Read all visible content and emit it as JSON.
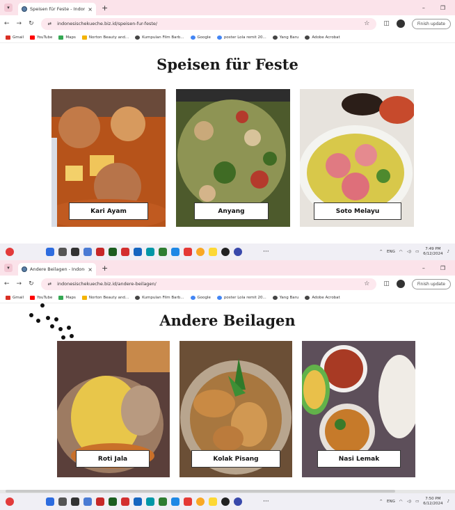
{
  "window1": {
    "tab_title": "Speisen für Feste - Indonesisch",
    "url": "indonesischekueche.biz.id/speisen-fur-feste/",
    "page_title": "Speisen für Feste",
    "cards": [
      {
        "label": "Kari Ayam"
      },
      {
        "label": "Anyang"
      },
      {
        "label": "Soto Melayu"
      }
    ],
    "clock_time": "7:49 PM",
    "clock_date": "6/12/2024"
  },
  "window2": {
    "tab_title": "Andere Beilagen - Indonesische",
    "url": "indonesischekueche.biz.id/andere-beilagen/",
    "page_title": "Andere Beilagen",
    "cards": [
      {
        "label": "Roti Jala"
      },
      {
        "label": "Kolak Pisang"
      },
      {
        "label": "Nasi Lemak"
      }
    ],
    "clock_time": "7:50 PM",
    "clock_date": "6/12/2024"
  },
  "browser": {
    "finish_update": "Finish update",
    "bookmarks": [
      "Gmail",
      "YouTube",
      "Maps",
      "Norton Beauty and...",
      "Kumpulan Film Barb...",
      "Google",
      "poster Lola remit 20...",
      "Yang Baru",
      "Adobe Acrobat"
    ],
    "bookmark_colors": [
      "#d93025",
      "#ff0000",
      "#34a853",
      "#f4b400",
      "#444444",
      "#4285f4",
      "#4285f4",
      "#444444",
      "#444444"
    ]
  },
  "tray": {
    "lang": "ENG"
  },
  "icons": {
    "taskbar_colors": [
      "#2d6cdf",
      "#555555",
      "#333333",
      "#4a7bd4",
      "#c62828",
      "#1b5e20",
      "#d32f2f",
      "#1565c0",
      "#0097a7",
      "#2e7d32",
      "#1e88e5",
      "#e53935",
      "#f9a825",
      "#fdd835",
      "#222222",
      "#3949ab"
    ]
  }
}
